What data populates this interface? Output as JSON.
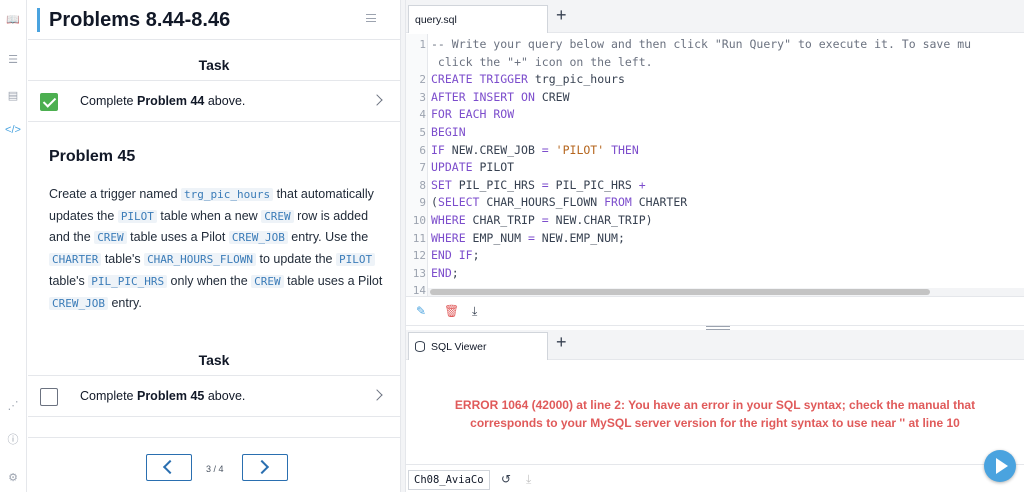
{
  "left_panel": {
    "title": "Problems 8.44-8.46",
    "task_heading_1": "Task",
    "task_1": {
      "prefix": "Complete ",
      "bold": "Problem 44",
      "suffix": " above.",
      "checked": true
    },
    "problem_title": "Problem 45",
    "desc": {
      "t1": "Create a trigger named ",
      "c1": "trg_pic_hours",
      "t2": " that automatically updates the ",
      "c2": "PILOT",
      "t3": " table when a new ",
      "c3": "CREW",
      "t4": " row is added and the ",
      "c4": "CREW",
      "t5": " table uses a Pilot ",
      "c5": "CREW_JOB",
      "t6": " entry. Use the ",
      "c6": "CHARTER",
      "t7": " table's ",
      "c7": "CHAR_HOURS_FLOWN",
      "t8": " to update the ",
      "c8": "PILOT",
      "t9": " table's ",
      "c9": "PIL_PIC_HRS",
      "t10": " only when the ",
      "c10": "CREW",
      "t11": " table uses a Pilot ",
      "c11": "CREW_JOB",
      "t12": " entry."
    },
    "task_heading_2": "Task",
    "task_2": {
      "prefix": "Complete ",
      "bold": "Problem 45",
      "suffix": " above.",
      "checked": false
    },
    "page_count": "3 / 4"
  },
  "rail_icons": [
    "book-icon",
    "list-icon",
    "chart-icon",
    "code-icon",
    "share-icon",
    "help-icon",
    "settings-icon"
  ],
  "editor": {
    "tab_label": "query.sql",
    "tab_plus": "+",
    "lines": [
      {
        "n": "1",
        "text": "-- Write your query below and then click \"Run Query\" to execute it. To save mu"
      },
      {
        "n": "",
        "text": "click the \"+\" icon on the left."
      },
      {
        "n": "2",
        "text": "CREATE TRIGGER trg_pic_hours"
      },
      {
        "n": "3",
        "text": "AFTER INSERT ON CREW"
      },
      {
        "n": "4",
        "text": "FOR EACH ROW"
      },
      {
        "n": "5",
        "text": "BEGIN"
      },
      {
        "n": "6",
        "text": "IF NEW.CREW_JOB = 'PILOT' THEN"
      },
      {
        "n": "7",
        "text": "UPDATE PILOT"
      },
      {
        "n": "8",
        "text": "SET PIL_PIC_HRS = PIL_PIC_HRS +"
      },
      {
        "n": "9",
        "text": "(SELECT CHAR_HOURS_FLOWN FROM CHARTER"
      },
      {
        "n": "10",
        "text": "WHERE CHAR_TRIP = NEW.CHAR_TRIP)"
      },
      {
        "n": "11",
        "text": "WHERE EMP_NUM = NEW.EMP_NUM;"
      },
      {
        "n": "12",
        "text": "END IF;"
      },
      {
        "n": "13",
        "text": "END;"
      },
      {
        "n": "14",
        "text": ""
      }
    ]
  },
  "viewer": {
    "tab_label": "SQL Viewer",
    "tab_plus": "+",
    "error": "ERROR 1064 (42000) at line 2: You have an error in your SQL syntax; check the manual that corresponds to your MySQL server version for the right syntax to use near '' at line 10"
  },
  "status": {
    "db_name": "Ch08_AviaCo"
  },
  "colors": {
    "accent": "#4aa3df",
    "check_green": "#4caf50",
    "error_red": "#e05a5a",
    "nav_blue": "#2a6fb0"
  }
}
